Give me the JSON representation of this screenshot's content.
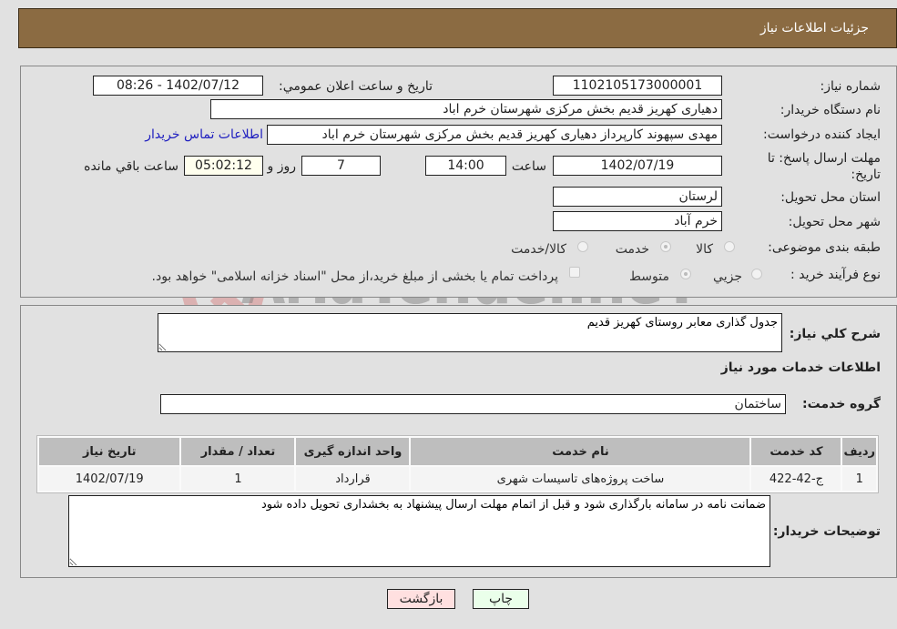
{
  "header": {
    "title": "جزئیات اطلاعات نیاز"
  },
  "form": {
    "need_number_label": "شماره نیاز:",
    "need_number": "1102105173000001",
    "announce_label": "تاریخ و ساعت اعلان عمومي:",
    "announce_value": "1402/07/12 - 08:26",
    "buyer_org_label": "نام دستگاه خریدار:",
    "buyer_org": "دهیاری کهریز قدیم بخش مرکزی شهرستان خرم اباد",
    "creator_label": "ایجاد کننده درخواست:",
    "creator": "مهدی سپهوند کارپرداز دهیاری کهریز قدیم بخش مرکزی شهرستان خرم اباد",
    "contact_link": "اطلاعات تماس خریدار",
    "deadline_label": "مهلت ارسال پاسخ: تا تاریخ:",
    "deadline_date": "1402/07/19",
    "time_label": "ساعت",
    "deadline_time": "14:00",
    "days_value": "7",
    "days_label": "روز و",
    "remaining_time": "05:02:12",
    "remaining_label": "ساعت باقي مانده",
    "province_label": "استان محل تحویل:",
    "province": "لرستان",
    "city_label": "شهر محل تحویل:",
    "city": "خرم آباد",
    "category_label": "طبقه بندی موضوعی:",
    "category_options": [
      "کالا",
      "خدمت",
      "کالا/خدمت"
    ],
    "category_selected": "خدمت",
    "process_label": "نوع فرآیند خرید :",
    "process_options": [
      "جزيي",
      "متوسط"
    ],
    "process_selected": "متوسط",
    "payment_note": "پرداخت تمام یا بخشی از مبلغ خرید،از محل \"اسناد خزانه اسلامی\" خواهد بود."
  },
  "details": {
    "summary_label": "شرح کلي نیاز:",
    "summary": "جدول گذاری معابر روستای کهریز قدیم",
    "services_title": "اطلاعات خدمات مورد نیاز",
    "service_group_label": "گروه خدمت:",
    "service_group": "ساختمان",
    "table": {
      "headers": [
        "ردیف",
        "کد خدمت",
        "نام خدمت",
        "واحد اندازه گیری",
        "تعداد / مقدار",
        "تاریخ نیاز"
      ],
      "rows": [
        [
          "1",
          "ج-42-422",
          "ساخت پروژه‌های تاسیسات شهری",
          "قرارداد",
          "1",
          "1402/07/19"
        ]
      ]
    },
    "buyer_notes_label": "توضیحات خریدار:",
    "buyer_notes": "ضمانت نامه در سامانه بارگذاری شود و قبل از اتمام مهلت ارسال پیشنهاد به بخشداری تحویل داده شود"
  },
  "buttons": {
    "print": "چاپ",
    "back": "بازگشت"
  },
  "colors": {
    "header_bg": "#8b6b42",
    "print_bg": "#eaffea",
    "back_bg": "#ffe0e0",
    "link": "#2020c0"
  },
  "watermark": {
    "text": "AriaTender.neT"
  }
}
